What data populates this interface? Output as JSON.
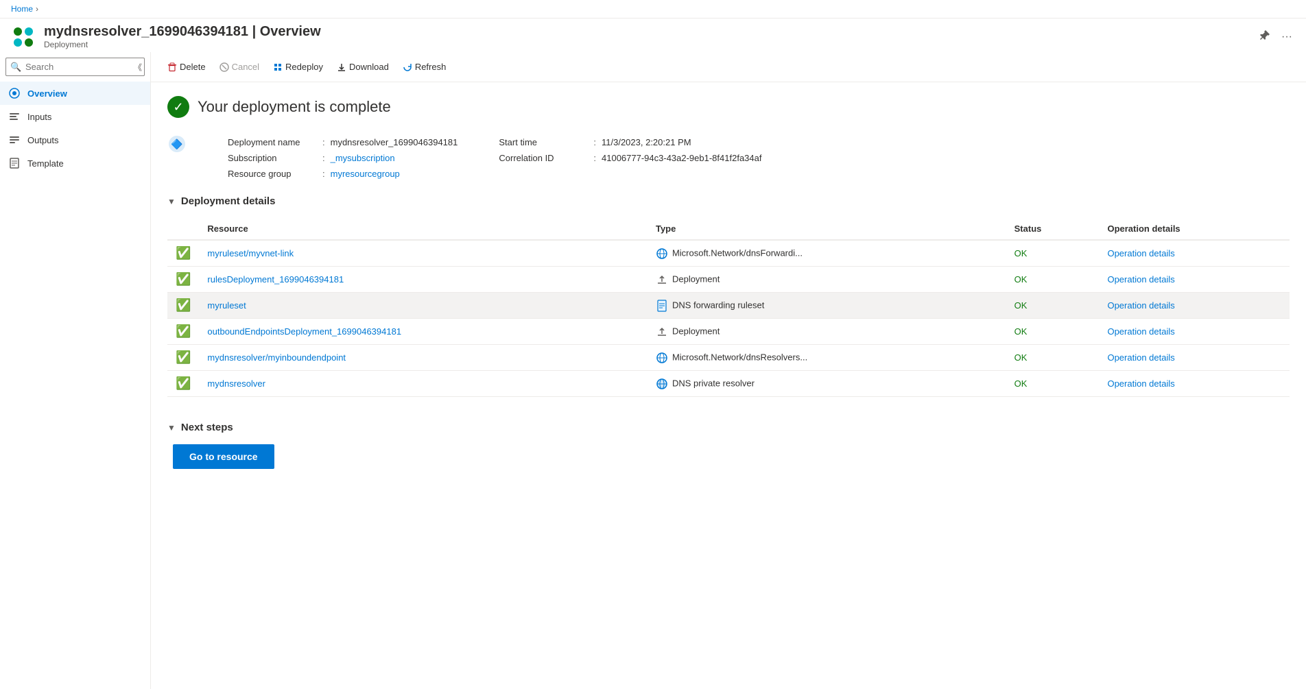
{
  "breadcrumb": {
    "home": "Home"
  },
  "header": {
    "title": "mydnsresolver_1699046394181 | Overview",
    "subtitle": "Deployment",
    "pin_label": "Pin",
    "more_label": "More options"
  },
  "toolbar": {
    "delete_label": "Delete",
    "cancel_label": "Cancel",
    "redeploy_label": "Redeploy",
    "download_label": "Download",
    "refresh_label": "Refresh"
  },
  "sidebar": {
    "search_placeholder": "Search",
    "items": [
      {
        "id": "overview",
        "label": "Overview",
        "active": true
      },
      {
        "id": "inputs",
        "label": "Inputs",
        "active": false
      },
      {
        "id": "outputs",
        "label": "Outputs",
        "active": false
      },
      {
        "id": "template",
        "label": "Template",
        "active": false
      }
    ]
  },
  "overview": {
    "status_title": "Your deployment is complete",
    "deployment_name_label": "Deployment name",
    "deployment_name_value": "mydnsresolver_1699046394181",
    "subscription_label": "Subscription",
    "subscription_value": "_mysubscription",
    "resource_group_label": "Resource group",
    "resource_group_value": "myresourcegroup",
    "start_time_label": "Start time",
    "start_time_value": "11/3/2023, 2:20:21 PM",
    "correlation_id_label": "Correlation ID",
    "correlation_id_value": "41006777-94c3-43a2-9eb1-8f41f2fa34af",
    "deployment_details_label": "Deployment details",
    "table_headers": {
      "resource": "Resource",
      "type": "Type",
      "status": "Status",
      "operation_details": "Operation details"
    },
    "rows": [
      {
        "resource": "myruleset/myvnet-link",
        "type": "Microsoft.Network/dnsForwardi...",
        "type_icon": "globe",
        "status": "OK",
        "op_details": "Operation details"
      },
      {
        "resource": "rulesDeployment_1699046394181",
        "type": "Deployment",
        "type_icon": "upload",
        "status": "OK",
        "op_details": "Operation details"
      },
      {
        "resource": "myruleset",
        "type": "DNS forwarding ruleset",
        "type_icon": "doc",
        "status": "OK",
        "op_details": "Operation details",
        "highlighted": true
      },
      {
        "resource": "outboundEndpointsDeployment_1699046394181",
        "type": "Deployment",
        "type_icon": "upload",
        "status": "OK",
        "op_details": "Operation details"
      },
      {
        "resource": "mydnsresolver/myinboundendpoint",
        "type": "Microsoft.Network/dnsResolvers...",
        "type_icon": "globe",
        "status": "OK",
        "op_details": "Operation details"
      },
      {
        "resource": "mydnsresolver",
        "type": "DNS private resolver",
        "type_icon": "dns-globe",
        "status": "OK",
        "op_details": "Operation details"
      }
    ],
    "next_steps_label": "Next steps",
    "go_to_resource_label": "Go to resource"
  }
}
